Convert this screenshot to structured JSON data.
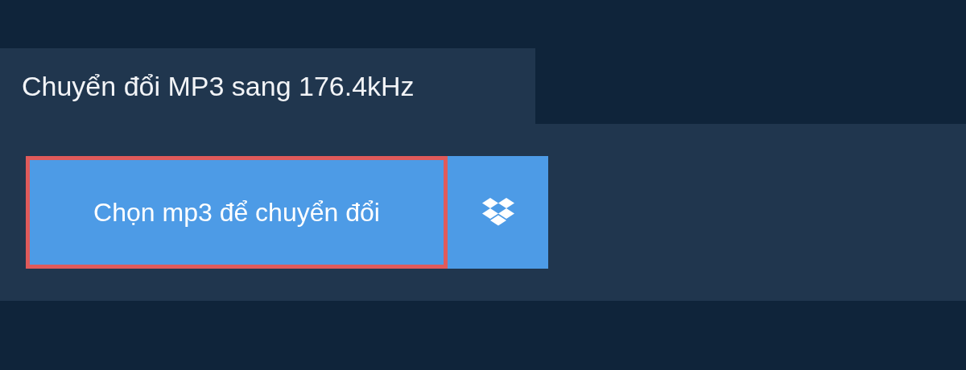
{
  "tab": {
    "title": "Chuyển đổi MP3 sang 176.4kHz"
  },
  "upload": {
    "button": "Chọn mp3 để chuyển đổi",
    "focused": true
  }
}
